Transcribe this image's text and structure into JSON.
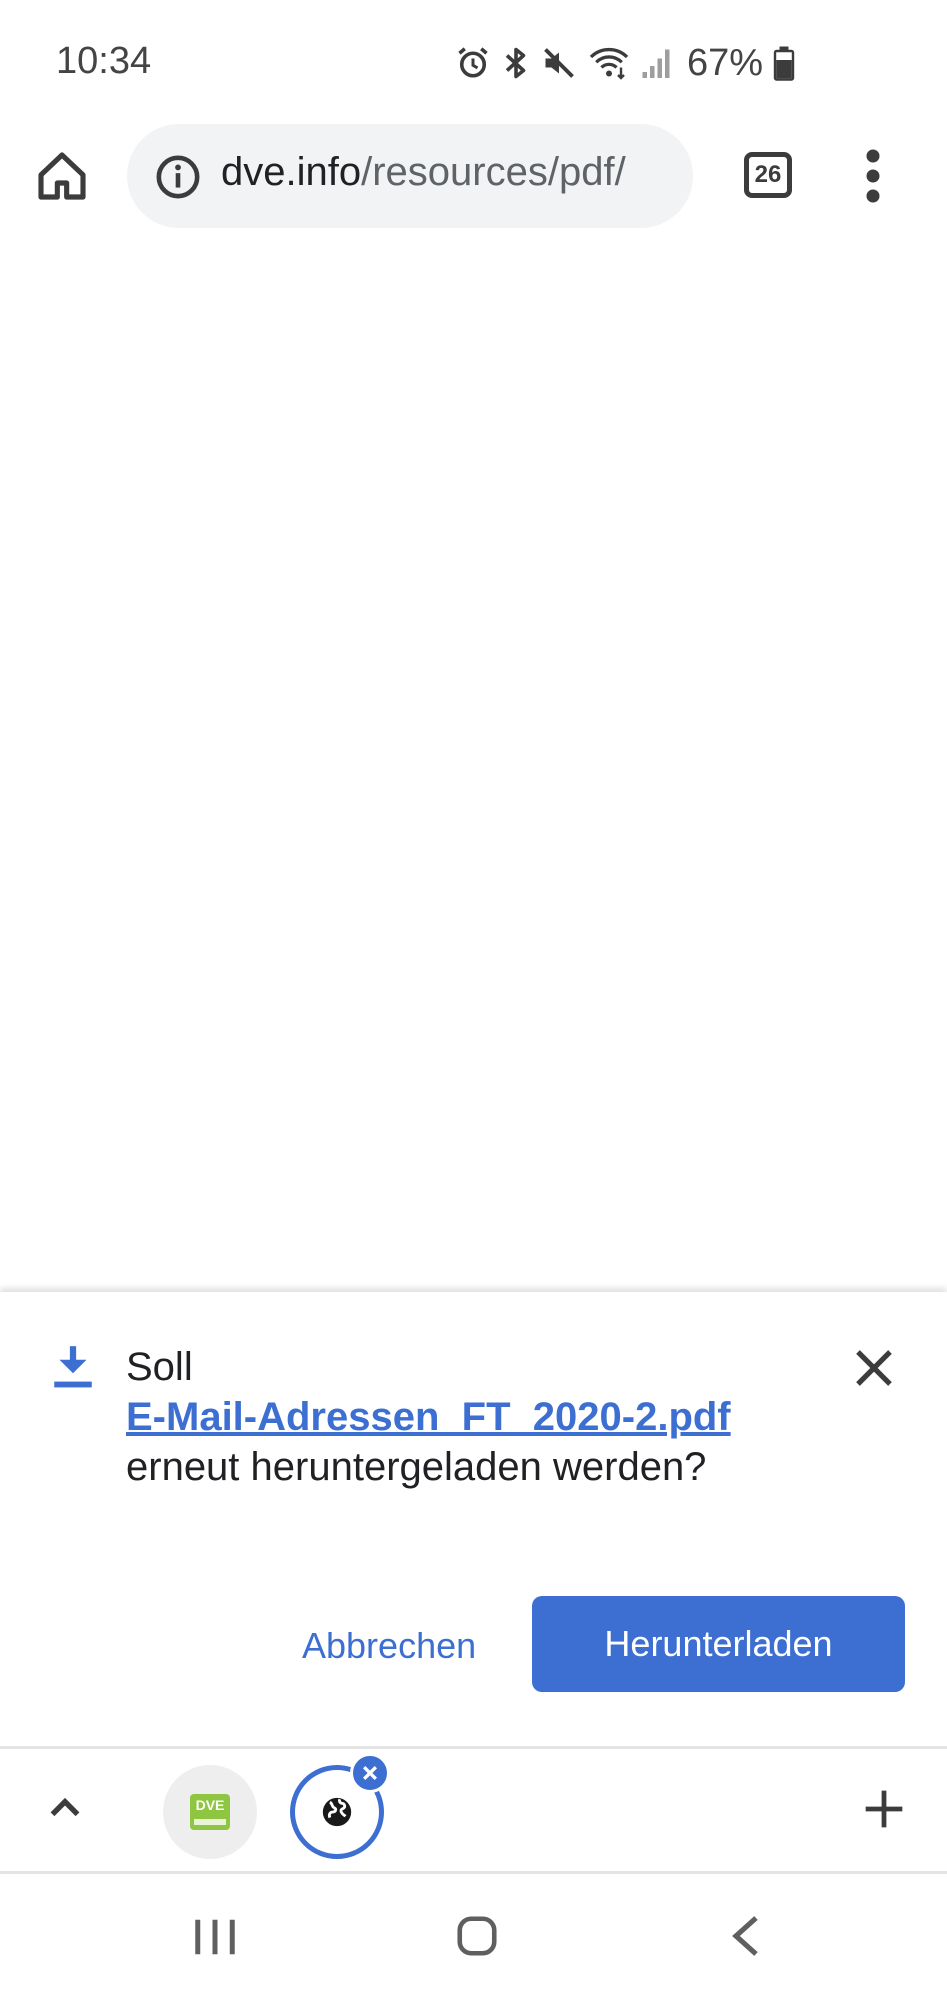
{
  "status_bar": {
    "time": "10:34",
    "battery_percent": "67%",
    "icons": [
      "alarm-icon",
      "bluetooth-icon",
      "mute-icon",
      "wifi-icon",
      "signal-icon",
      "battery-icon"
    ]
  },
  "toolbar": {
    "url_domain": "dve.info",
    "url_path": "/resources/pdf/",
    "tab_count": "26"
  },
  "download_dialog": {
    "line1": "Soll",
    "file_name": "E-Mail-Adressen_FT_2020-2.pdf",
    "line3": "erneut heruntergeladen werden?",
    "cancel_label": "Abbrechen",
    "download_label": "Herunterladen"
  },
  "tab_strip": {
    "tabs": [
      {
        "logo_text": "DVE",
        "active": false
      },
      {
        "icon": "globe-icon",
        "active": true
      }
    ]
  },
  "colors": {
    "accent": "#3c6fd1",
    "omnibox_bg": "#f1f3f4",
    "text": "#202124"
  }
}
